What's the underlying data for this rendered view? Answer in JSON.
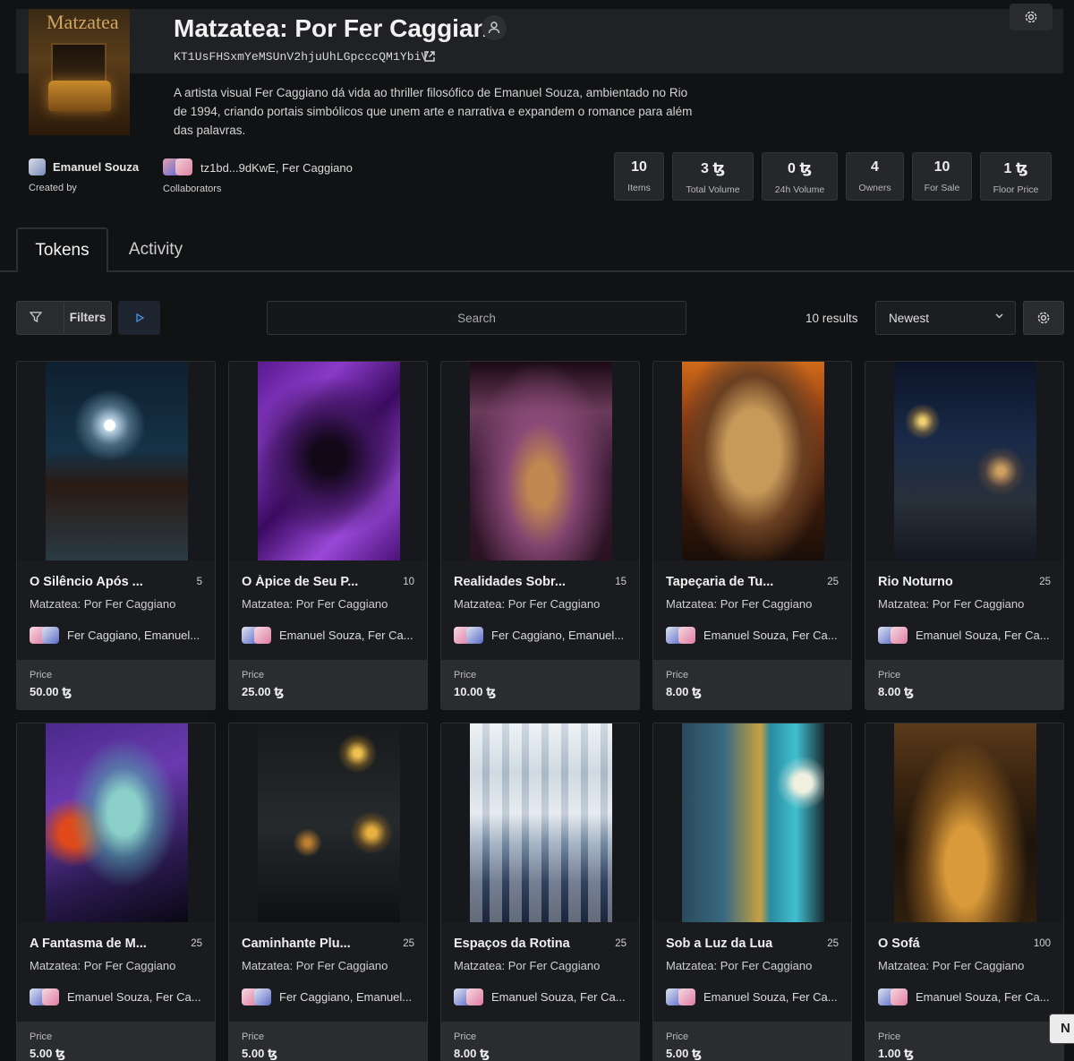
{
  "collection": {
    "title": "Matzatea: Por Fer Caggiano",
    "cover_text": "Matzatea",
    "address": "KT1UsFHSxmYeMSUnV2hjuUhLGpcccQM1YbiV",
    "description": "A artista visual Fer Caggiano dá vida ao thriller filosófico de Emanuel Souza, ambientado no Rio de 1994, criando portais simbólicos que unem arte e narrativa e expandem o romance para além das palavras.",
    "creator_name": "Emanuel Souza",
    "creator_label": "Created by",
    "collaborators_text": "tz1bd...9dKwE, Fer Caggiano",
    "collaborators_label": "Collaborators",
    "icons": {
      "user": "user-icon",
      "external": "external-link-icon",
      "settings": "gear-icon"
    }
  },
  "stats": [
    {
      "value": "10",
      "label": "Items"
    },
    {
      "value": "3 ꜩ",
      "label": "Total Volume"
    },
    {
      "value": "0 ꜩ",
      "label": "24h Volume"
    },
    {
      "value": "4",
      "label": "Owners"
    },
    {
      "value": "10",
      "label": "For Sale"
    },
    {
      "value": "1 ꜩ",
      "label": "Floor Price"
    }
  ],
  "tabs": [
    {
      "label": "Tokens",
      "active": true
    },
    {
      "label": "Activity",
      "active": false
    }
  ],
  "toolbar": {
    "filters_label": "Filters",
    "search_placeholder": "Search",
    "results_text": "10 results",
    "sort_value": "Newest"
  },
  "tokens": [
    {
      "title": "O Silêncio Após ...",
      "edition": "5",
      "collection": "Matzatea: Por Fer Caggiano",
      "creators": "Fer Caggiano, Emanuel...",
      "price_label": "Price",
      "price": "50.00 ꜩ"
    },
    {
      "title": "O Ápice de Seu P...",
      "edition": "10",
      "collection": "Matzatea: Por Fer Caggiano",
      "creators": "Emanuel Souza, Fer Ca...",
      "price_label": "Price",
      "price": "25.00 ꜩ"
    },
    {
      "title": "Realidades Sobr...",
      "edition": "15",
      "collection": "Matzatea: Por Fer Caggiano",
      "creators": "Fer Caggiano, Emanuel...",
      "price_label": "Price",
      "price": "10.00 ꜩ"
    },
    {
      "title": "Tapeçaria de Tu...",
      "edition": "25",
      "collection": "Matzatea: Por Fer Caggiano",
      "creators": "Emanuel Souza, Fer Ca...",
      "price_label": "Price",
      "price": "8.00 ꜩ"
    },
    {
      "title": "Rio Noturno",
      "edition": "25",
      "collection": "Matzatea: Por Fer Caggiano",
      "creators": "Emanuel Souza, Fer Ca...",
      "price_label": "Price",
      "price": "8.00 ꜩ"
    },
    {
      "title": "A Fantasma de M...",
      "edition": "25",
      "collection": "Matzatea: Por Fer Caggiano",
      "creators": "Emanuel Souza, Fer Ca...",
      "price_label": "Price",
      "price": "5.00 ꜩ"
    },
    {
      "title": "Caminhante Plu...",
      "edition": "25",
      "collection": "Matzatea: Por Fer Caggiano",
      "creators": "Fer Caggiano, Emanuel...",
      "price_label": "Price",
      "price": "5.00 ꜩ"
    },
    {
      "title": "Espaços da Rotina",
      "edition": "25",
      "collection": "Matzatea: Por Fer Caggiano",
      "creators": "Emanuel Souza, Fer Ca...",
      "price_label": "Price",
      "price": "8.00 ꜩ"
    },
    {
      "title": "Sob a Luz da Lua",
      "edition": "25",
      "collection": "Matzatea: Por Fer Caggiano",
      "creators": "Emanuel Souza, Fer Ca...",
      "price_label": "Price",
      "price": "5.00 ꜩ"
    },
    {
      "title": "O Sofá",
      "edition": "100",
      "collection": "Matzatea: Por Fer Caggiano",
      "creators": "Emanuel Souza, Fer Ca...",
      "price_label": "Price",
      "price": "1.00 ꜩ"
    }
  ],
  "corner_button_text": "N"
}
